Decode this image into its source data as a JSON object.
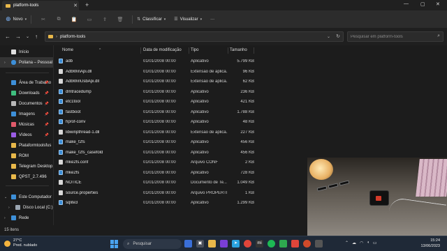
{
  "window": {
    "tab_title": "platform-tools"
  },
  "toolbar": {
    "new_label": "Novo",
    "sort_label": "Classificar",
    "view_label": "Visualizar",
    "more_label": "···"
  },
  "address": {
    "path": "platform-tools",
    "search_placeholder": "Pesquisar em platform-tools"
  },
  "sidebar": {
    "items": [
      {
        "label": "Início",
        "icon": "home-icon",
        "color": "#e0e0e0"
      },
      {
        "label": "Poliana – Pessoal",
        "icon": "cloud-icon",
        "color": "#3d8fd8"
      },
      {
        "label": "Área de Trabalho",
        "icon": "desktop-icon",
        "color": "#3d8fd8"
      },
      {
        "label": "Downloads",
        "icon": "download-icon",
        "color": "#3fbf7f"
      },
      {
        "label": "Documentos",
        "icon": "documents-icon",
        "color": "#b8b8b8"
      },
      {
        "label": "Imagens",
        "icon": "pictures-icon",
        "color": "#3d8fd8"
      },
      {
        "label": "Músicas",
        "icon": "music-icon",
        "color": "#e05a6a"
      },
      {
        "label": "Vídeos",
        "icon": "videos-icon",
        "color": "#9b5de5"
      },
      {
        "label": "Plataformtoolsfus",
        "icon": "folder-icon",
        "color": "#e8b84a"
      },
      {
        "label": "ROM",
        "icon": "folder-icon",
        "color": "#e8b84a"
      },
      {
        "label": "Telegram Desktop",
        "icon": "folder-icon",
        "color": "#e8b84a"
      },
      {
        "label": "QPST_2.7.496",
        "icon": "folder-icon",
        "color": "#e8b84a"
      },
      {
        "label": "Este Computador",
        "icon": "computer-icon",
        "color": "#3d8fd8"
      },
      {
        "label": "Disco Local (C:)",
        "icon": "drive-icon",
        "color": "#9aa5b1"
      },
      {
        "label": "Rede",
        "icon": "network-icon",
        "color": "#3d8fd8"
      }
    ]
  },
  "columns": {
    "name": "Nome",
    "date": "Data de modificação",
    "type": "Tipo",
    "size": "Tamanho"
  },
  "files": [
    {
      "name": "adb",
      "date": "01/01/2008 00:00",
      "type": "Aplicativo",
      "size": "5.799 KB",
      "kind": "app"
    },
    {
      "name": "AdbWinApi.dll",
      "date": "01/01/2008 00:00",
      "type": "Extensão de aplica...",
      "size": "96 KB",
      "kind": "doc"
    },
    {
      "name": "AdbWinUsbApi.dll",
      "date": "01/01/2008 00:00",
      "type": "Extensão de aplica...",
      "size": "62 KB",
      "kind": "doc"
    },
    {
      "name": "dmtracedump",
      "date": "01/01/2008 00:00",
      "type": "Aplicativo",
      "size": "236 KB",
      "kind": "app"
    },
    {
      "name": "etc1tool",
      "date": "01/01/2008 00:00",
      "type": "Aplicativo",
      "size": "421 KB",
      "kind": "app"
    },
    {
      "name": "fastboot",
      "date": "01/01/2008 00:00",
      "type": "Aplicativo",
      "size": "1.788 KB",
      "kind": "app"
    },
    {
      "name": "hprof-conv",
      "date": "01/01/2008 00:00",
      "type": "Aplicativo",
      "size": "48 KB",
      "kind": "app"
    },
    {
      "name": "libwinpthread-1.dll",
      "date": "01/01/2008 00:00",
      "type": "Extensão de aplica...",
      "size": "227 KB",
      "kind": "doc"
    },
    {
      "name": "make_f2fs",
      "date": "01/01/2008 00:00",
      "type": "Aplicativo",
      "size": "456 KB",
      "kind": "app"
    },
    {
      "name": "make_f2fs_casefold",
      "date": "01/01/2008 00:00",
      "type": "Aplicativo",
      "size": "456 KB",
      "kind": "app"
    },
    {
      "name": "mke2fs.conf",
      "date": "01/01/2008 00:00",
      "type": "Arquivo CONF",
      "size": "2 KB",
      "kind": "doc"
    },
    {
      "name": "mke2fs",
      "date": "01/01/2008 00:00",
      "type": "Aplicativo",
      "size": "728 KB",
      "kind": "app"
    },
    {
      "name": "NOTICE",
      "date": "01/01/2008 00:00",
      "type": "Documento de Te...",
      "size": "1.049 KB",
      "kind": "doc"
    },
    {
      "name": "source.properties",
      "date": "01/01/2008 00:00",
      "type": "Arquivo PROPERTI...",
      "size": "1 KB",
      "kind": "doc"
    },
    {
      "name": "sqlite3",
      "date": "01/01/2008 00:00",
      "type": "Aplicativo",
      "size": "1.299 KB",
      "kind": "app"
    }
  ],
  "status": {
    "count": "15 itens"
  },
  "taskbar": {
    "temp": "27°C",
    "weather": "Pred. nublado",
    "search_label": "Pesquisar",
    "time": "15:24",
    "date": "13/06/2023"
  },
  "colors": {
    "accent": "#3d8fd8",
    "folder": "#e8b84a"
  }
}
